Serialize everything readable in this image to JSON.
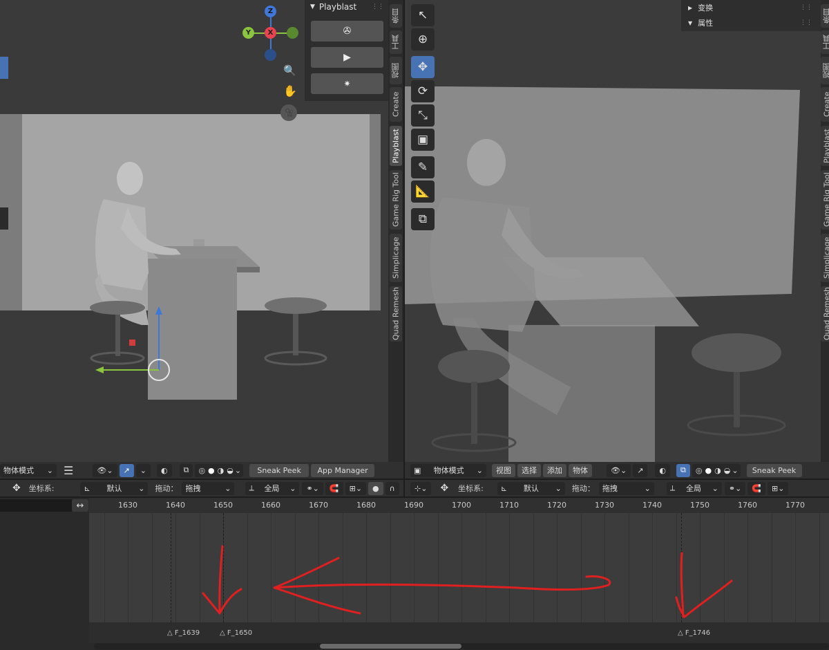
{
  "playblast": {
    "title": "Playblast",
    "icons": [
      "film-reel-icon",
      "play-icon",
      "settings-sparkle-icon"
    ]
  },
  "gizmo": {
    "z": "Z",
    "y": "Y",
    "x": "X"
  },
  "left_tabs": [
    "条目",
    "工具",
    "视图",
    "Create",
    "Playblast",
    "Game Rig Tool",
    "Simplicage",
    "Quad Remesh"
  ],
  "right_tabs": [
    "条目",
    "工具",
    "视图",
    "Create",
    "Playblast",
    "Game Rig Tool",
    "Simplicage",
    "Quad Remesh"
  ],
  "right_panel": {
    "transform": "变换",
    "properties": "属性"
  },
  "left_header": {
    "mode": "物体模式",
    "sneak_peek": "Sneak Peek",
    "app_manager": "App Manager"
  },
  "right_header": {
    "mode": "物体模式",
    "view": "视图",
    "select": "选择",
    "add": "添加",
    "object": "物体",
    "sneak_peek": "Sneak Peek"
  },
  "left_tool_header": {
    "coord_label": "坐标系:",
    "coord_value": "默认",
    "drag_label": "拖动：",
    "drag_value": "拖拽",
    "pivot_value": "全局"
  },
  "right_tool_header": {
    "coord_label": "坐标系:",
    "coord_value": "默认",
    "drag_label": "拖动：",
    "drag_value": "拖拽",
    "pivot_value": "全局"
  },
  "timeline": {
    "ticks": [
      "1630",
      "1640",
      "1650",
      "1660",
      "1670",
      "1680",
      "1690",
      "1700",
      "1710",
      "1720",
      "1730",
      "1740",
      "1750",
      "1760",
      "1770"
    ],
    "markers": [
      "F_1639",
      "F_1650",
      "F_1746"
    ]
  },
  "colors": {
    "accent": "#4772b3",
    "axis_x": "#e8434f",
    "axis_y": "#8bc43f",
    "axis_z": "#3f78d8",
    "annotation": "#e02020"
  }
}
